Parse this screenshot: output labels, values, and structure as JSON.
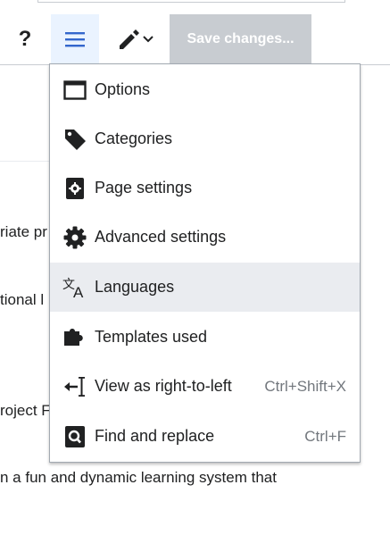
{
  "toolbar": {
    "help_label": "?",
    "save_label": "Save changes..."
  },
  "page_text": {
    "line1": "riate pr",
    "line2": "tional l",
    "line3": "roject F",
    "line4": "n a fun and dynamic learning system that"
  },
  "menu": {
    "items": [
      {
        "label": "Options",
        "icon": "window-icon",
        "shortcut": ""
      },
      {
        "label": "Categories",
        "icon": "tag-icon",
        "shortcut": ""
      },
      {
        "label": "Page settings",
        "icon": "page-settings-icon",
        "shortcut": ""
      },
      {
        "label": "Advanced settings",
        "icon": "gear-icon",
        "shortcut": ""
      },
      {
        "label": "Languages",
        "icon": "language-icon",
        "shortcut": ""
      },
      {
        "label": "Templates used",
        "icon": "puzzle-icon",
        "shortcut": ""
      },
      {
        "label": "View as right-to-left",
        "icon": "text-direction-icon",
        "shortcut": "Ctrl+Shift+X"
      },
      {
        "label": "Find and replace",
        "icon": "find-replace-icon",
        "shortcut": "Ctrl+F"
      }
    ],
    "highlighted_item": "Languages"
  },
  "colors": {
    "menu_button_bg": "#eaf3ff",
    "menu_icon": "#3366cc",
    "save_disabled_bg": "#c8ccd1",
    "highlight_bg": "#eaecf0"
  }
}
